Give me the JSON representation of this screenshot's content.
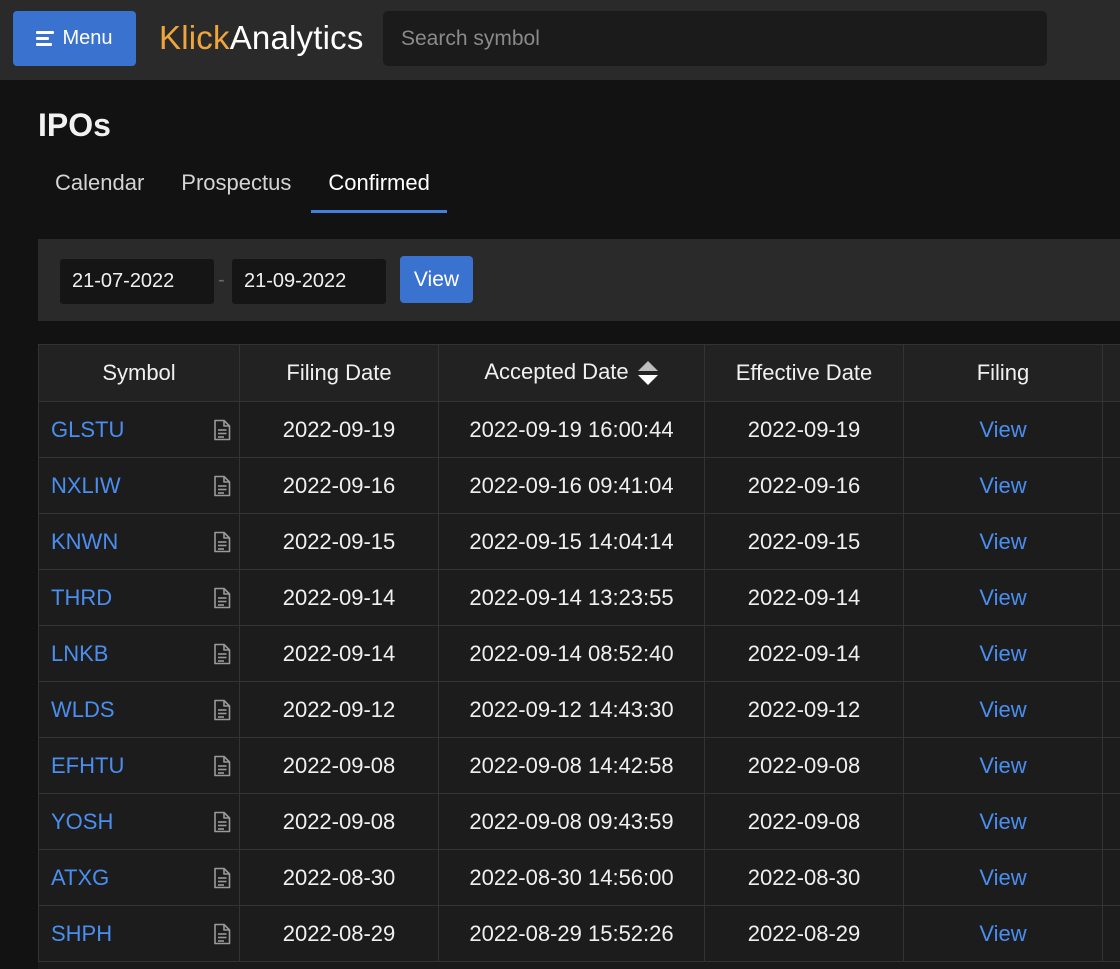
{
  "header": {
    "menu_label": "Menu",
    "brand_part1": "Klick",
    "brand_part2": "Analytics",
    "search_placeholder": "Search symbol"
  },
  "page": {
    "title": "IPOs",
    "tabs": [
      {
        "label": "Calendar",
        "active": false
      },
      {
        "label": "Prospectus",
        "active": false
      },
      {
        "label": "Confirmed",
        "active": true
      }
    ]
  },
  "filter": {
    "from_date": "21-07-2022",
    "to_date": "21-09-2022",
    "separator": "-",
    "view_label": "View"
  },
  "table": {
    "columns": [
      "Symbol",
      "Filing Date",
      "Accepted Date",
      "Effective Date",
      "Filing"
    ],
    "rows": [
      {
        "symbol": "GLSTU",
        "filing_date": "2022-09-19",
        "accepted_date": "2022-09-19 16:00:44",
        "effective_date": "2022-09-19",
        "filing": "View"
      },
      {
        "symbol": "NXLIW",
        "filing_date": "2022-09-16",
        "accepted_date": "2022-09-16 09:41:04",
        "effective_date": "2022-09-16",
        "filing": "View"
      },
      {
        "symbol": "KNWN",
        "filing_date": "2022-09-15",
        "accepted_date": "2022-09-15 14:04:14",
        "effective_date": "2022-09-15",
        "filing": "View"
      },
      {
        "symbol": "THRD",
        "filing_date": "2022-09-14",
        "accepted_date": "2022-09-14 13:23:55",
        "effective_date": "2022-09-14",
        "filing": "View"
      },
      {
        "symbol": "LNKB",
        "filing_date": "2022-09-14",
        "accepted_date": "2022-09-14 08:52:40",
        "effective_date": "2022-09-14",
        "filing": "View"
      },
      {
        "symbol": "WLDS",
        "filing_date": "2022-09-12",
        "accepted_date": "2022-09-12 14:43:30",
        "effective_date": "2022-09-12",
        "filing": "View"
      },
      {
        "symbol": "EFHTU",
        "filing_date": "2022-09-08",
        "accepted_date": "2022-09-08 14:42:58",
        "effective_date": "2022-09-08",
        "filing": "View"
      },
      {
        "symbol": "YOSH",
        "filing_date": "2022-09-08",
        "accepted_date": "2022-09-08 09:43:59",
        "effective_date": "2022-09-08",
        "filing": "View"
      },
      {
        "symbol": "ATXG",
        "filing_date": "2022-08-30",
        "accepted_date": "2022-08-30 14:56:00",
        "effective_date": "2022-08-30",
        "filing": "View"
      },
      {
        "symbol": "SHPH",
        "filing_date": "2022-08-29",
        "accepted_date": "2022-08-29 15:52:26",
        "effective_date": "2022-08-29",
        "filing": "View"
      }
    ]
  },
  "colors": {
    "accent": "#3a72d0",
    "link": "#4a8ef0",
    "brand_orange": "#f0a53a",
    "background": "#121212",
    "panel": "#2a2a2a"
  },
  "icons": {
    "menu": "hamburger-menu-icon",
    "document": "document-icon",
    "sort": "sort-icon"
  }
}
